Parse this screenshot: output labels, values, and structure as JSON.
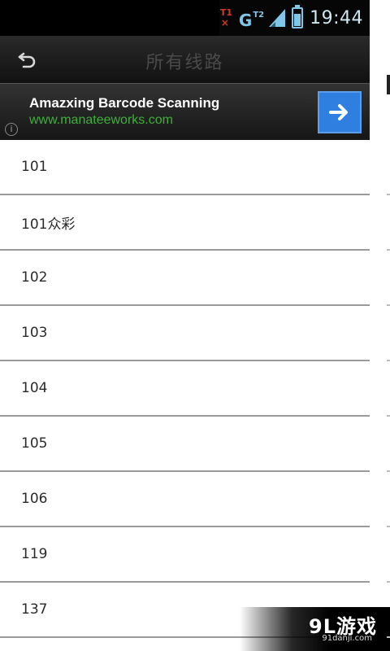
{
  "status_bar": {
    "sim_top": "T1",
    "sim_bottom": "×",
    "network": "G",
    "network_sup": "T2",
    "time": "19:44"
  },
  "action_bar": {
    "back_icon": "back-arrow-icon",
    "title": "所有线路"
  },
  "ad": {
    "title": "Amazxing Barcode Scanning",
    "url": "www.manateeworks.com",
    "info_icon": "info-icon",
    "info_glyph": "i",
    "arrow_icon": "arrow-right-icon",
    "button_color": "#2f7fe0"
  },
  "routes": [
    "101",
    "101众彩",
    "102",
    "103",
    "104",
    "105",
    "106",
    "119",
    "137"
  ],
  "watermark": {
    "logo": "9L游戏",
    "site": "91danji.com"
  }
}
